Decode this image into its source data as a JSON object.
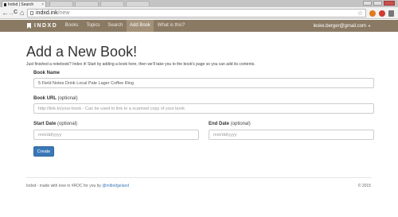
{
  "browser": {
    "tab_title": "Indxd | Search",
    "tab_close": "×",
    "url_host": "indxd.ink",
    "url_path": "/new",
    "back_icon": "←",
    "forward_icon": "→",
    "reload_icon": "C",
    "home_icon": "⌂",
    "star_icon": "☆"
  },
  "navbar": {
    "brand": "INDXD",
    "items": [
      {
        "label": "Books"
      },
      {
        "label": "Topics"
      },
      {
        "label": "Search"
      },
      {
        "label": "Add Book",
        "active": true
      },
      {
        "label": "What is this?"
      }
    ],
    "user": "leske.berger@gmail.com",
    "caret": "▼"
  },
  "main": {
    "title": "Add a New Book!",
    "lead": "Just finished a notebook? Index it! Start by adding a book here, then we'll take you to the book's page so you can add its contents.",
    "book_name": {
      "label": "Book Name",
      "value": "5 Field Notes Drink Local Pale Lager Coffee Ring"
    },
    "book_url": {
      "label": "Book URL",
      "optional": "(optional)",
      "placeholder": "http://link.to/your-book - Can be used to link to a scanned copy of your book"
    },
    "start_date": {
      "label": "Start Date",
      "optional": "(optional)",
      "placeholder": "mm/dd/yyyy"
    },
    "end_date": {
      "label": "End Date",
      "optional": "(optional)",
      "placeholder": "mm/dd/yyyy"
    },
    "create_label": "Create"
  },
  "footer": {
    "text": "Indxd - made with love in #ROC for you by",
    "link": "@mlbridgeland",
    "copyright": "© 2015"
  },
  "colors": {
    "navbar": "#8a7a64",
    "navbar_active": "#a29178",
    "button": "#3a78b8"
  }
}
